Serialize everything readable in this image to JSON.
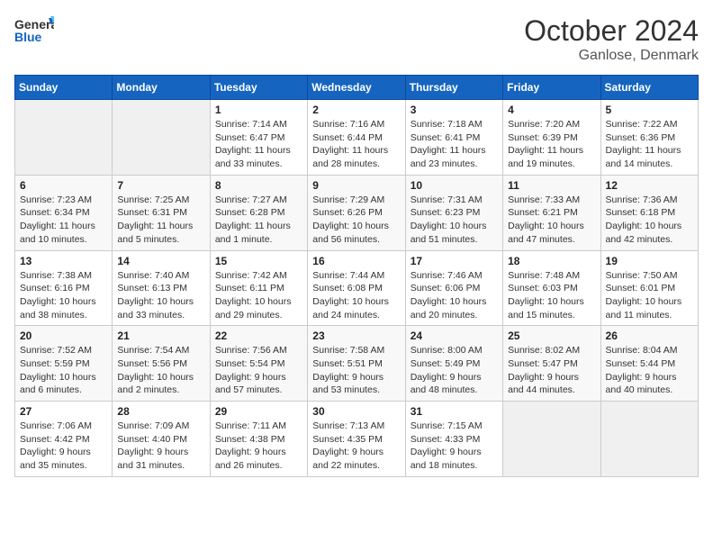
{
  "logo": {
    "text_general": "General",
    "text_blue": "Blue"
  },
  "header": {
    "month_title": "October 2024",
    "location": "Ganlose, Denmark"
  },
  "weekdays": [
    "Sunday",
    "Monday",
    "Tuesday",
    "Wednesday",
    "Thursday",
    "Friday",
    "Saturday"
  ],
  "weeks": [
    [
      {
        "day": "",
        "detail": ""
      },
      {
        "day": "",
        "detail": ""
      },
      {
        "day": "1",
        "detail": "Sunrise: 7:14 AM\nSunset: 6:47 PM\nDaylight: 11 hours\nand 33 minutes."
      },
      {
        "day": "2",
        "detail": "Sunrise: 7:16 AM\nSunset: 6:44 PM\nDaylight: 11 hours\nand 28 minutes."
      },
      {
        "day": "3",
        "detail": "Sunrise: 7:18 AM\nSunset: 6:41 PM\nDaylight: 11 hours\nand 23 minutes."
      },
      {
        "day": "4",
        "detail": "Sunrise: 7:20 AM\nSunset: 6:39 PM\nDaylight: 11 hours\nand 19 minutes."
      },
      {
        "day": "5",
        "detail": "Sunrise: 7:22 AM\nSunset: 6:36 PM\nDaylight: 11 hours\nand 14 minutes."
      }
    ],
    [
      {
        "day": "6",
        "detail": "Sunrise: 7:23 AM\nSunset: 6:34 PM\nDaylight: 11 hours\nand 10 minutes."
      },
      {
        "day": "7",
        "detail": "Sunrise: 7:25 AM\nSunset: 6:31 PM\nDaylight: 11 hours\nand 5 minutes."
      },
      {
        "day": "8",
        "detail": "Sunrise: 7:27 AM\nSunset: 6:28 PM\nDaylight: 11 hours\nand 1 minute."
      },
      {
        "day": "9",
        "detail": "Sunrise: 7:29 AM\nSunset: 6:26 PM\nDaylight: 10 hours\nand 56 minutes."
      },
      {
        "day": "10",
        "detail": "Sunrise: 7:31 AM\nSunset: 6:23 PM\nDaylight: 10 hours\nand 51 minutes."
      },
      {
        "day": "11",
        "detail": "Sunrise: 7:33 AM\nSunset: 6:21 PM\nDaylight: 10 hours\nand 47 minutes."
      },
      {
        "day": "12",
        "detail": "Sunrise: 7:36 AM\nSunset: 6:18 PM\nDaylight: 10 hours\nand 42 minutes."
      }
    ],
    [
      {
        "day": "13",
        "detail": "Sunrise: 7:38 AM\nSunset: 6:16 PM\nDaylight: 10 hours\nand 38 minutes."
      },
      {
        "day": "14",
        "detail": "Sunrise: 7:40 AM\nSunset: 6:13 PM\nDaylight: 10 hours\nand 33 minutes."
      },
      {
        "day": "15",
        "detail": "Sunrise: 7:42 AM\nSunset: 6:11 PM\nDaylight: 10 hours\nand 29 minutes."
      },
      {
        "day": "16",
        "detail": "Sunrise: 7:44 AM\nSunset: 6:08 PM\nDaylight: 10 hours\nand 24 minutes."
      },
      {
        "day": "17",
        "detail": "Sunrise: 7:46 AM\nSunset: 6:06 PM\nDaylight: 10 hours\nand 20 minutes."
      },
      {
        "day": "18",
        "detail": "Sunrise: 7:48 AM\nSunset: 6:03 PM\nDaylight: 10 hours\nand 15 minutes."
      },
      {
        "day": "19",
        "detail": "Sunrise: 7:50 AM\nSunset: 6:01 PM\nDaylight: 10 hours\nand 11 minutes."
      }
    ],
    [
      {
        "day": "20",
        "detail": "Sunrise: 7:52 AM\nSunset: 5:59 PM\nDaylight: 10 hours\nand 6 minutes."
      },
      {
        "day": "21",
        "detail": "Sunrise: 7:54 AM\nSunset: 5:56 PM\nDaylight: 10 hours\nand 2 minutes."
      },
      {
        "day": "22",
        "detail": "Sunrise: 7:56 AM\nSunset: 5:54 PM\nDaylight: 9 hours\nand 57 minutes."
      },
      {
        "day": "23",
        "detail": "Sunrise: 7:58 AM\nSunset: 5:51 PM\nDaylight: 9 hours\nand 53 minutes."
      },
      {
        "day": "24",
        "detail": "Sunrise: 8:00 AM\nSunset: 5:49 PM\nDaylight: 9 hours\nand 48 minutes."
      },
      {
        "day": "25",
        "detail": "Sunrise: 8:02 AM\nSunset: 5:47 PM\nDaylight: 9 hours\nand 44 minutes."
      },
      {
        "day": "26",
        "detail": "Sunrise: 8:04 AM\nSunset: 5:44 PM\nDaylight: 9 hours\nand 40 minutes."
      }
    ],
    [
      {
        "day": "27",
        "detail": "Sunrise: 7:06 AM\nSunset: 4:42 PM\nDaylight: 9 hours\nand 35 minutes."
      },
      {
        "day": "28",
        "detail": "Sunrise: 7:09 AM\nSunset: 4:40 PM\nDaylight: 9 hours\nand 31 minutes."
      },
      {
        "day": "29",
        "detail": "Sunrise: 7:11 AM\nSunset: 4:38 PM\nDaylight: 9 hours\nand 26 minutes."
      },
      {
        "day": "30",
        "detail": "Sunrise: 7:13 AM\nSunset: 4:35 PM\nDaylight: 9 hours\nand 22 minutes."
      },
      {
        "day": "31",
        "detail": "Sunrise: 7:15 AM\nSunset: 4:33 PM\nDaylight: 9 hours\nand 18 minutes."
      },
      {
        "day": "",
        "detail": ""
      },
      {
        "day": "",
        "detail": ""
      }
    ]
  ]
}
